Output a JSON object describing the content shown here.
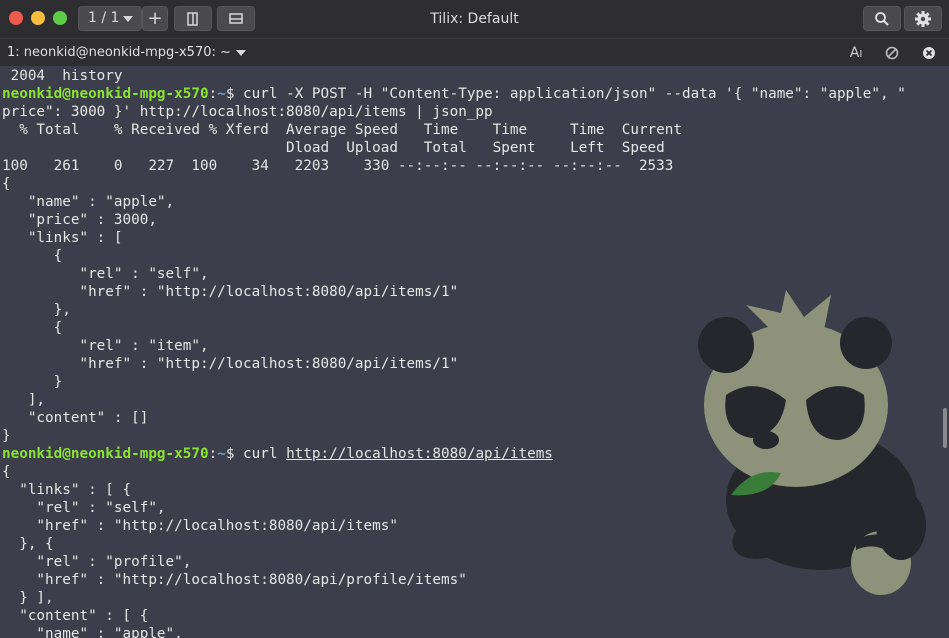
{
  "window": {
    "title": "Tilix: Default",
    "session_counter": "1 / 1",
    "add_label": "+"
  },
  "tab": {
    "label": "1: neonkid@neonkid-mpg-x570: ~"
  },
  "colors": {
    "prompt_user": "#8ae234",
    "prompt_path": "#729fcf",
    "background": "#3c3f4b"
  },
  "terminal": {
    "prompt_user": "neonkid@neonkid-mpg-x570",
    "prompt_path": "~",
    "line_history": " 2004  history",
    "cmd1_a": "$ curl -X POST -H \"Content-Type: application/json\" --data '{ \"name\": \"apple\", \"",
    "cmd1_b": "price\": 3000 }' http://localhost:8080/api/items | json_pp",
    "curl_header1": "  % Total    % Received % Xferd  Average Speed   Time    Time     Time  Current",
    "curl_header2": "                                 Dload  Upload   Total   Spent    Left  Speed",
    "curl_stats": "100   261    0   227  100    34   2203    330 --:--:-- --:--:-- --:--:--  2533",
    "out1": "{\n   \"name\" : \"apple\",\n   \"price\" : 3000,\n   \"links\" : [\n      {\n         \"rel\" : \"self\",\n         \"href\" : \"http://localhost:8080/api/items/1\"\n      },\n      {\n         \"rel\" : \"item\",\n         \"href\" : \"http://localhost:8080/api/items/1\"\n      }\n   ],\n   \"content\" : []\n}",
    "cmd2_prefix": "$ curl ",
    "cmd2_url": "http://localhost:8080/api/items",
    "out2": "{\n  \"links\" : [ {\n    \"rel\" : \"self\",\n    \"href\" : \"http://localhost:8080/api/items\"\n  }, {\n    \"rel\" : \"profile\",\n    \"href\" : \"http://localhost:8080/api/profile/items\"\n  } ],\n  \"content\" : [ {\n    \"name\" : \"apple\","
  }
}
